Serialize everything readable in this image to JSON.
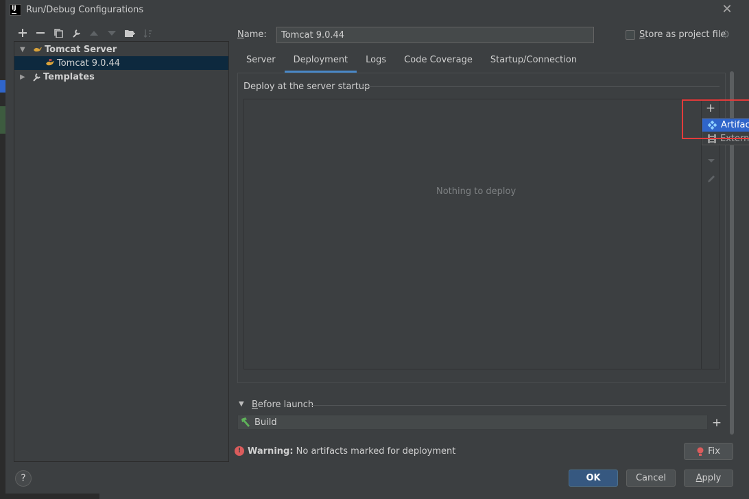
{
  "window": {
    "title": "Run/Debug Configurations",
    "app_icon_text": "IJ"
  },
  "toolbar": {
    "icons": [
      "plus-icon",
      "minus-icon",
      "copy-icon",
      "wrench-icon",
      "arrow-up-icon",
      "arrow-down-icon",
      "folder-add-icon",
      "sort-icon"
    ]
  },
  "tree": {
    "items": [
      {
        "label": "Tomcat Server",
        "expanded": true
      },
      {
        "label": "Tomcat 9.0.44",
        "selected": true
      },
      {
        "label": "Templates",
        "expanded": false
      }
    ]
  },
  "help": {
    "label": "?"
  },
  "config": {
    "name_label_prefix": "N",
    "name_label_rest": "ame:",
    "name_value": "Tomcat 9.0.44",
    "store_label_prefix": "S",
    "store_label_rest": "tore as project file",
    "store_checked": false
  },
  "tabs": [
    {
      "label": "Server"
    },
    {
      "label": "Deployment",
      "active": true
    },
    {
      "label": "Logs"
    },
    {
      "label": "Code Coverage"
    },
    {
      "label": "Startup/Connection"
    }
  ],
  "deployment": {
    "section_title": "Deploy at the server startup",
    "empty_text": "Nothing to deploy",
    "add_label": "+",
    "popup": [
      {
        "label": "Artifact...",
        "selected": true
      },
      {
        "label": "External Source...",
        "selected": false
      }
    ]
  },
  "before_launch": {
    "title_prefix": "B",
    "title_rest": "efore launch",
    "task": "Build",
    "add_label": "+"
  },
  "warning": {
    "bold": "Warning:",
    "text": " No artifacts marked for deployment",
    "fix_label": "Fix"
  },
  "buttons": {
    "ok": "OK",
    "cancel": "Cancel",
    "apply_prefix": "A",
    "apply_rest": "pply"
  },
  "colors": {
    "accent": "#4a88c7",
    "selection": "#0d293e",
    "popup_selection": "#2f65ca",
    "warning": "#db5c5c",
    "highlight_box": "#e43b3b"
  }
}
